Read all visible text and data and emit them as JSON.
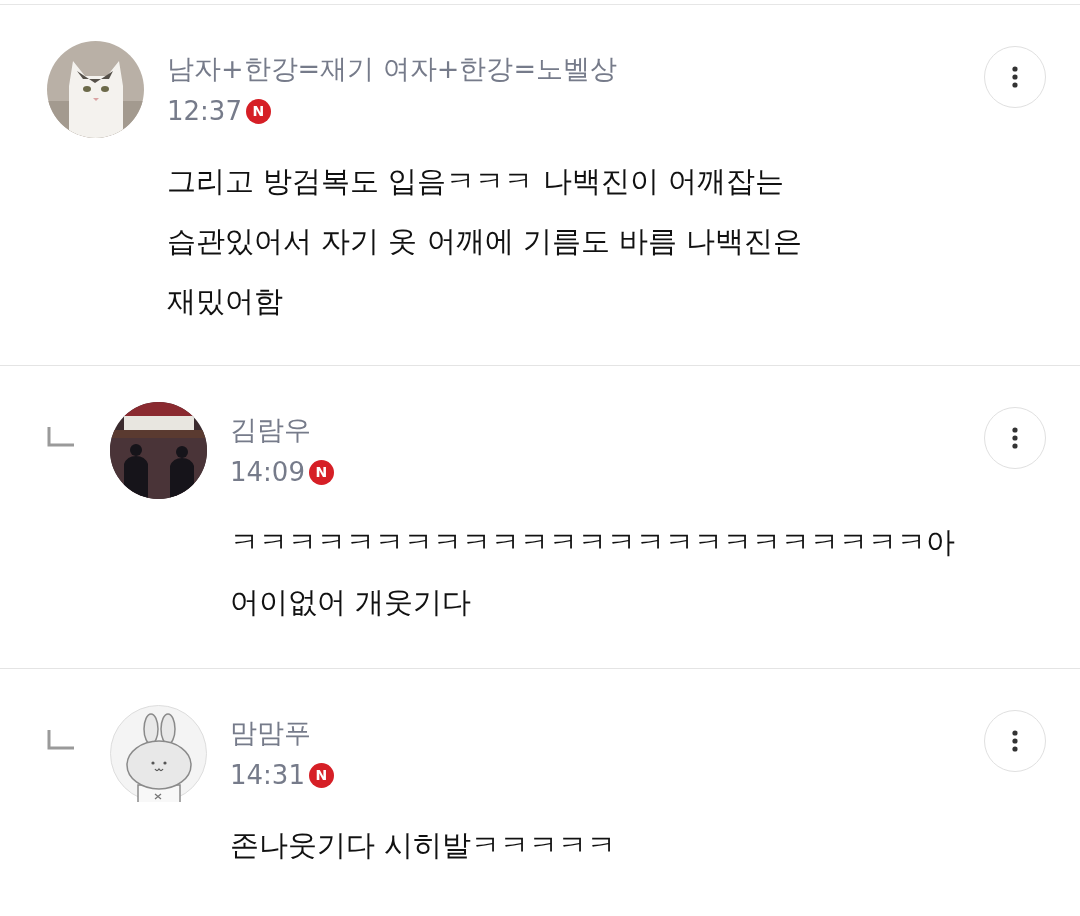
{
  "comments": [
    {
      "kind": "comment",
      "avatar": {
        "kind": "cat"
      },
      "author": "남자+한강=재기 여자+한강=노벨상",
      "time": "12:37",
      "badge": "N",
      "lines": [
        "그리고 방검복도 입음ㅋㅋㅋ 나백진이 어깨잡는",
        "습관있어서 자기 옷 어깨에 기름도 바름 나백진은",
        "재밌어함"
      ]
    },
    {
      "kind": "reply",
      "avatar": {
        "kind": "people"
      },
      "author": "김람우",
      "time": "14:09",
      "badge": "N",
      "lines": [
        "ㅋㅋㅋㅋㅋㅋㅋㅋㅋㅋㅋㅋㅋㅋㅋㅋㅋㅋㅋㅋㅋㅋㅋㅋ아",
        "어이없어 개웃기다"
      ]
    },
    {
      "kind": "reply",
      "avatar": {
        "kind": "rabbit"
      },
      "author": "맘맘푸",
      "time": "14:31",
      "badge": "N",
      "lines": [
        "존나웃기다 시히발ㅋㅋㅋㅋㅋ"
      ]
    }
  ]
}
